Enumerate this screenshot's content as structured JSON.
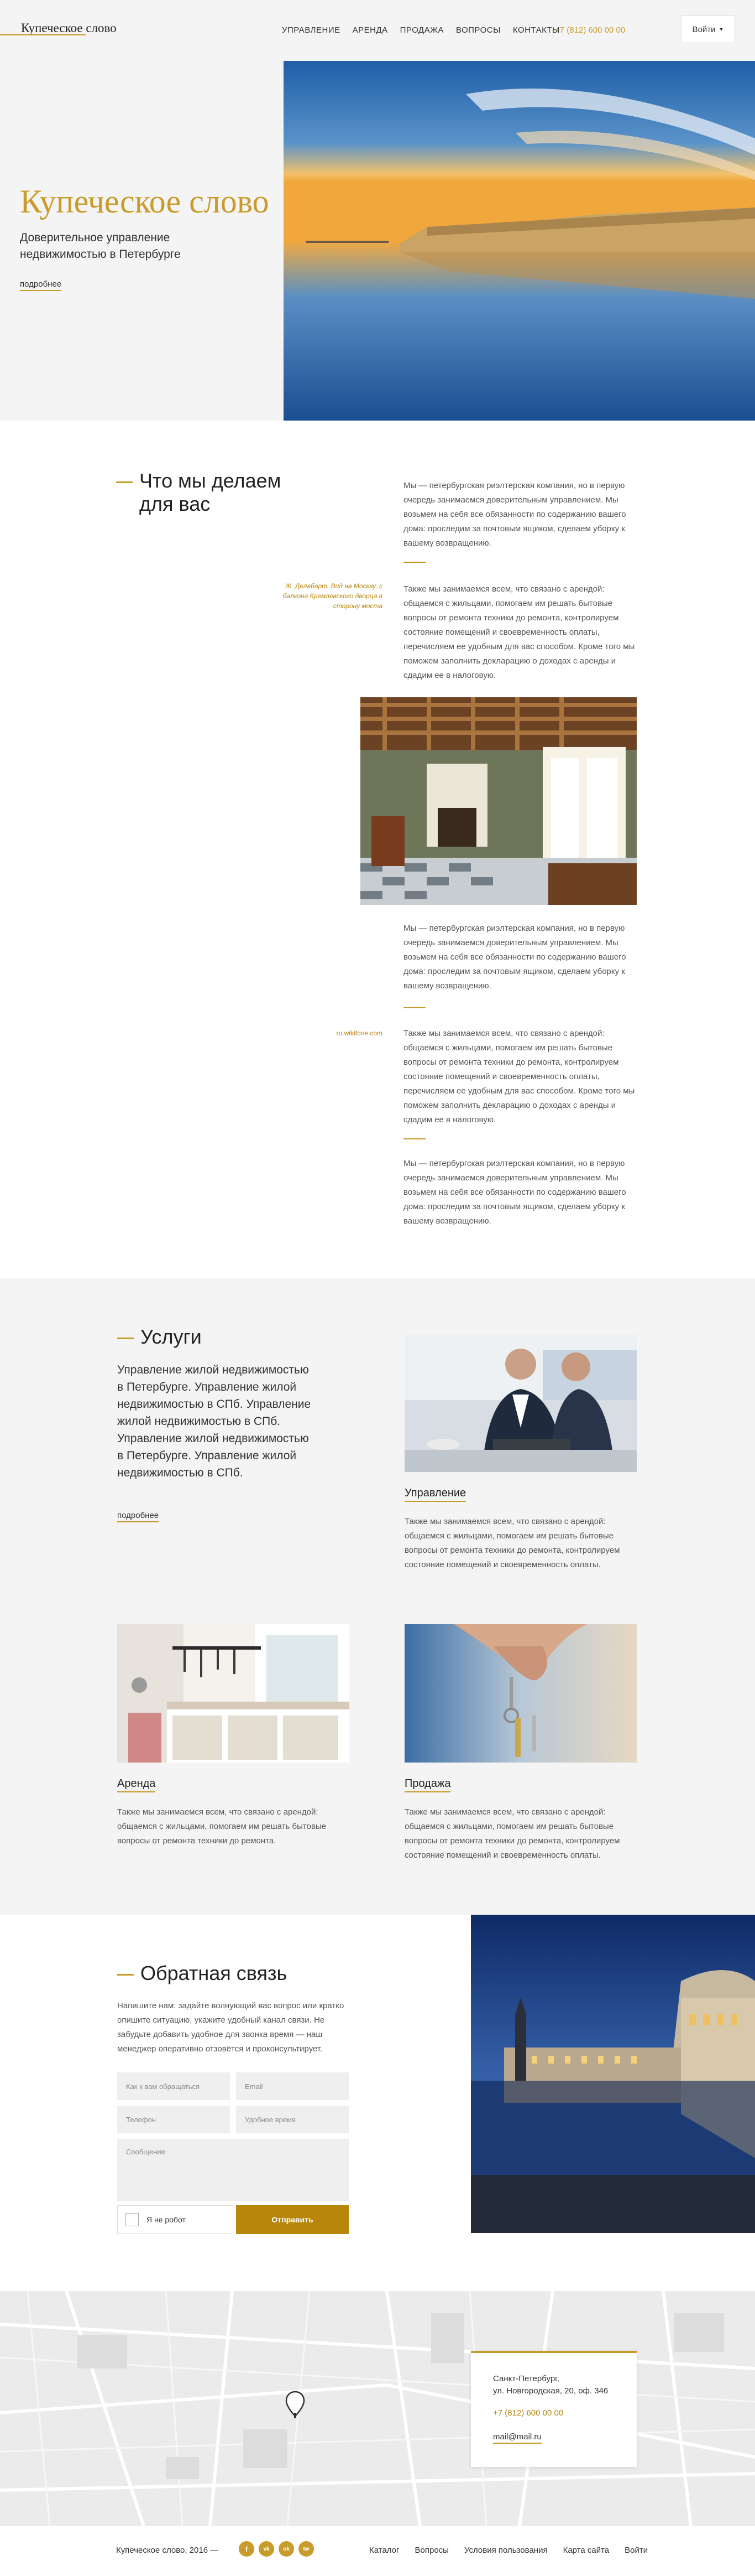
{
  "header": {
    "logo": "Купеческое слово",
    "nav": [
      "УПРАВЛЕНИЕ",
      "АРЕНДА",
      "ПРОДАЖА",
      "ВОПРОСЫ",
      "КОНТАКТЫ"
    ],
    "phone": "+7 (812) 600 00 00",
    "login": "Войти"
  },
  "hero": {
    "title": "Купеческое слово",
    "subtitle": "Доверительное управление недвижимостью в Петербурге",
    "more": "подробнее"
  },
  "what_we_do": {
    "title_line1": "Что мы делаем",
    "title_line2": "для вас",
    "para1": "Мы — петербургская риэлтерская компания, но в первую очередь занимаемся доверительным управлением. Мы возьмем на себя все обязанности по содержанию вашего дома: проследим за почтовым ящиком, сделаем уборку к вашему возвращению.",
    "para2": "Также мы занимаемся всем, что связано с арендой: общаемся с жильцами, помогаем им решать бытовые вопросы от ремонта техники до ремонта, контролируем состояние помещений и своевременность оплаты, перечисляем ее удобным для вас способом. Кроме того мы поможем заполнить декларацию о доходах с аренды и сдадим ее в налоговую.",
    "quote": "Ж. Делабарт. Вид на Москву, с балкона Кремлевского дворца в сторону моста",
    "para3": "Мы — петербургская риэлтерская компания, но в первую очередь занимаемся доверительным управлением. Мы возьмем на себя все обязанности по содержанию вашего дома: проследим за почтовым ящиком, сделаем уборку к вашему возвращению.",
    "source": "ru.wikifone.com",
    "para4": "Также мы занимаемся всем, что связано с арендой: общаемся с жильцами, помогаем им решать бытовые вопросы от ремонта техники до ремонта, контролируем состояние помещений и своевременность оплаты, перечисляем ее удобным для вас способом. Кроме того мы поможем заполнить декларацию о доходах с аренды и сдадим ее в налоговую.",
    "para5": "Мы — петербургская риэлтерская компания, но в первую очередь занимаемся доверительным управлением. Мы возьмем на себя все обязанности по содержанию вашего дома: проследим за почтовым ящиком, сделаем уборку к вашему возвращению."
  },
  "services": {
    "title": "Услуги",
    "description": "Управление жилой недвижимостью в Петербурге. Управление жилой недвижимостью в СПб. Управление жилой недвижимостью в СПб. Управление жилой недвижимостью в Петербурге. Управление жилой недвижимостью в СПб.",
    "more": "подробнее",
    "items": [
      {
        "name": "Управление",
        "text": "Также мы занимаемся всем, что связано с арендой: общаемся с жильцами, помогаем им решать бытовые вопросы от ремонта техники до ремонта, контролируем состояние помещений и своевременность оплаты."
      },
      {
        "name": "Аренда",
        "text": "Также мы занимаемся всем, что связано с арендой: общаемся с жильцами, помогаем им решать бытовые вопросы от ремонта техники до ремонта."
      },
      {
        "name": "Продажа",
        "text": "Также мы занимаемся всем, что связано с арендой: общаемся с жильцами, помогаем им решать бытовые вопросы от ремонта техники до ремонта, контролируем состояние помещений и своевременность оплаты."
      }
    ]
  },
  "feedback": {
    "title": "Обратная связь",
    "text": "Напишите нам: задайте волнующий вас вопрос или кратко опишите ситуацию, укажите удобный канал связи. Не забудьте добавить удобное для звонка время — наш менеджер оперативно отзовётся и проконсультирует.",
    "name_placeholder": "Как к вам обращаться",
    "email_placeholder": "Email",
    "phone_placeholder": "Телефон",
    "time_placeholder": "Удобное время",
    "message_placeholder": "Сообщение",
    "robot": "Я не робот",
    "send": "Отправить"
  },
  "map": {
    "address_line1": "Санкт-Петербург,",
    "address_line2": "ул. Новгородская, 20, оф. 346",
    "phone": "+7 (812) 600 00 00",
    "email": "mail@mail.ru"
  },
  "footer": {
    "brand": "Купеческое слово, 2016 —",
    "socials": [
      "f",
      "vk",
      "ok",
      "tw"
    ],
    "links": [
      "Каталог",
      "Вопросы",
      "Условия пользования",
      "Карта сайта",
      "Войти"
    ]
  }
}
